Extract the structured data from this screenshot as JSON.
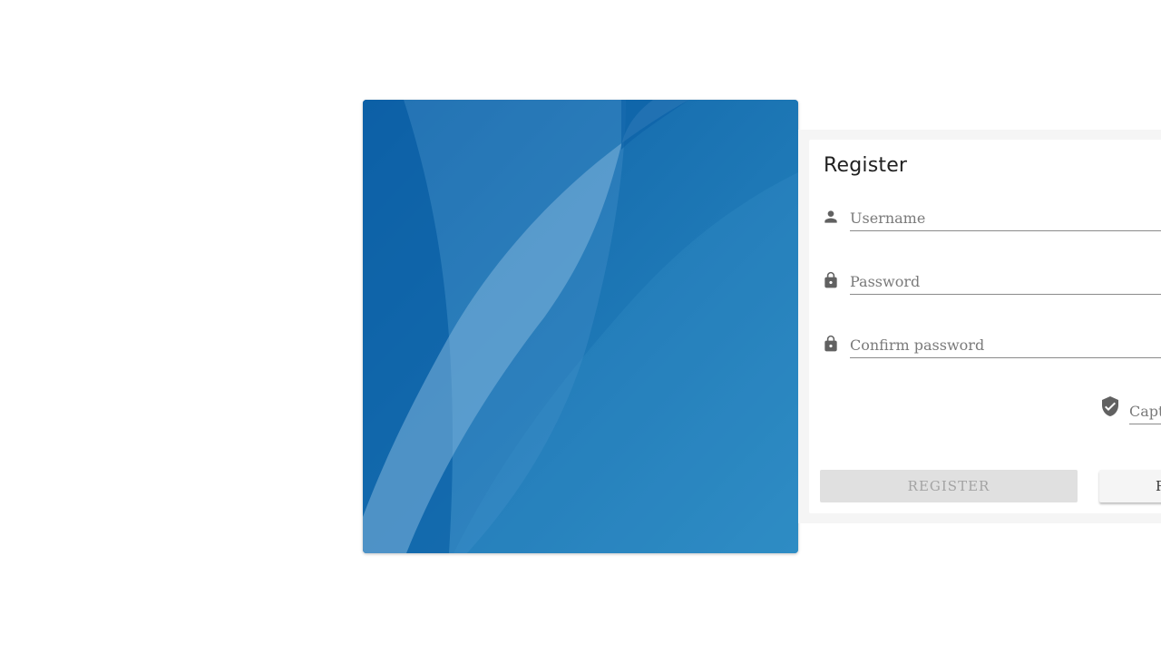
{
  "register_card": {
    "title": "Register",
    "username": {
      "placeholder": "Username",
      "value": ""
    },
    "password": {
      "placeholder": "Password",
      "value": ""
    },
    "confirm_password": {
      "placeholder": "Confirm password",
      "value": ""
    },
    "captcha": {
      "placeholder": "Captcha",
      "value": ""
    },
    "register_button": {
      "label": "REGISTER",
      "disabled": true
    },
    "second_button": {
      "label": "R"
    }
  },
  "icons": {
    "username": "person-icon",
    "password": "lock-icon",
    "confirm_password": "lock-icon",
    "captcha": "shield-check-icon"
  },
  "colors": {
    "hero_primary": "#0d63a8",
    "hero_secondary": "#3d8cc6",
    "icon": "#616161",
    "disabled_button_bg": "#e0e0e0",
    "disabled_button_text": "#a3a3a3"
  }
}
